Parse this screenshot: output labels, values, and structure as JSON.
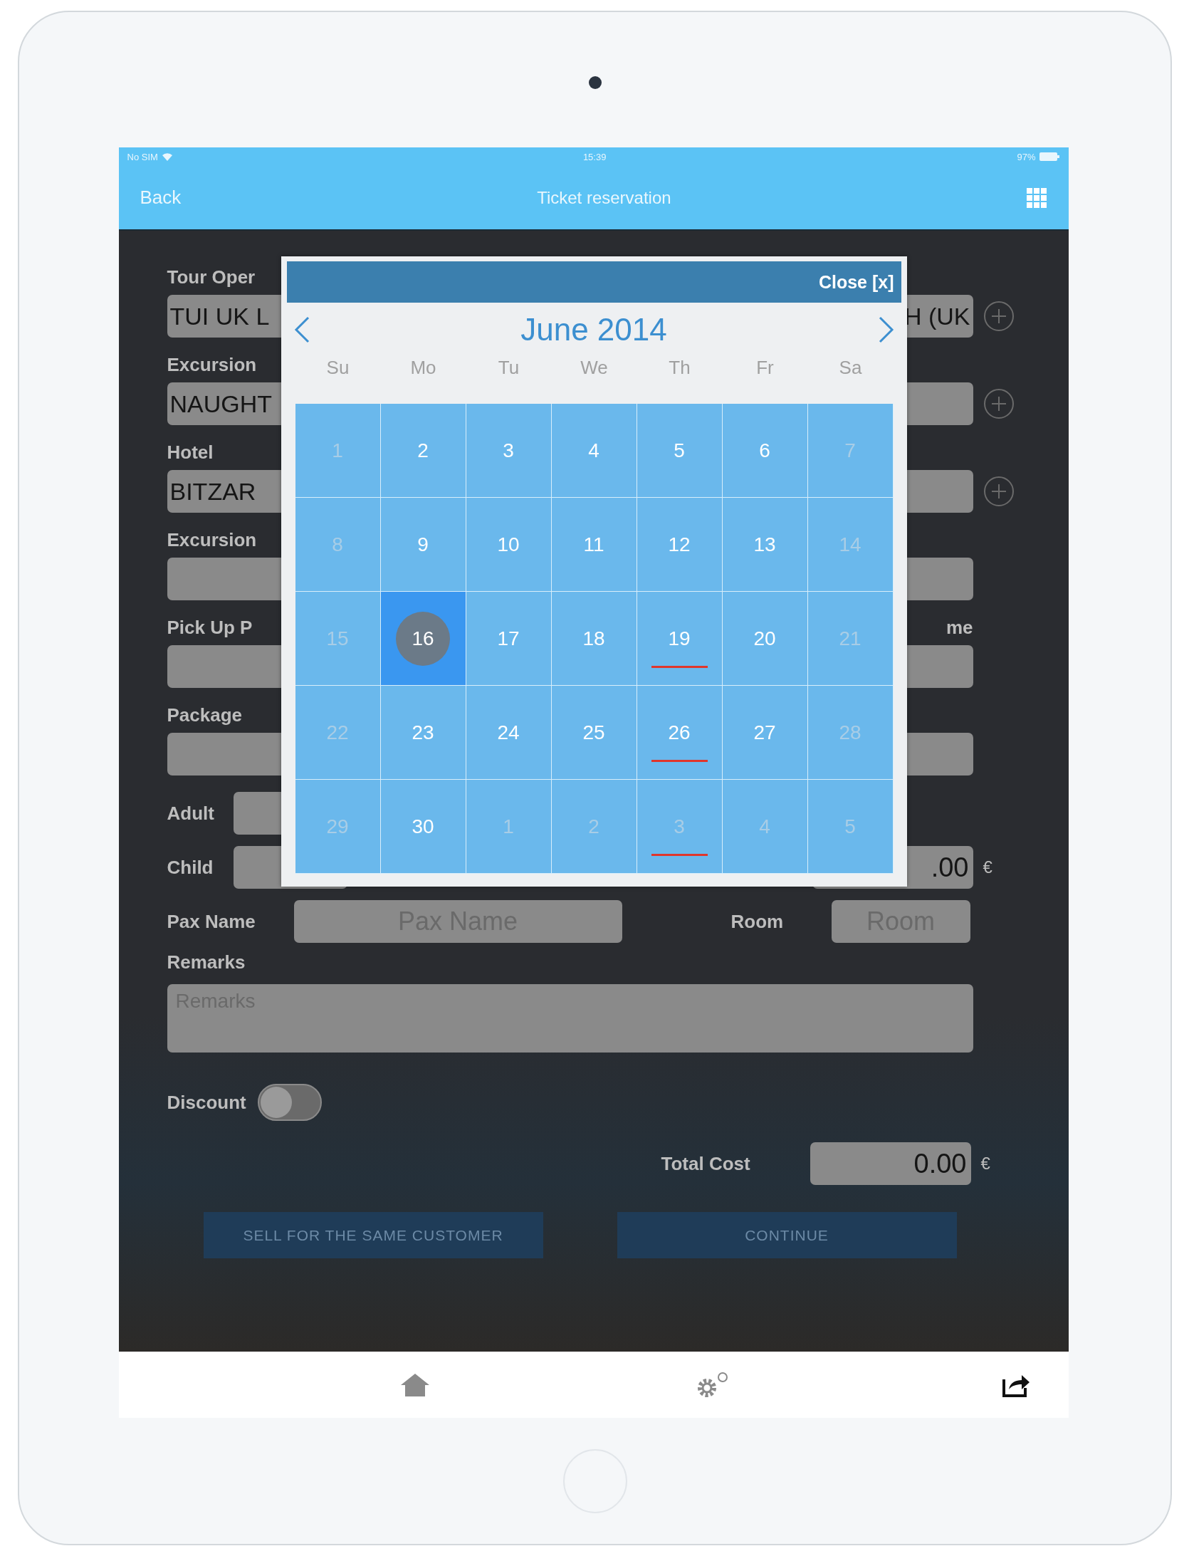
{
  "status_bar": {
    "carrier": "No SIM",
    "time": "15:39",
    "battery": "97%"
  },
  "nav_bar": {
    "back": "Back",
    "title": "Ticket reservation"
  },
  "form": {
    "rows": [
      {
        "label": "Tour Oper",
        "value": "TUI UK L",
        "value_end": "H (UK",
        "add": true
      },
      {
        "label": "Excursion",
        "value": "NAUGHT",
        "add": true
      },
      {
        "label": "Hotel",
        "value": "BITZAR",
        "add": true
      },
      {
        "label": "Excursion",
        "add": false
      },
      {
        "label": "Pick Up P",
        "right_label": "me",
        "add": false
      },
      {
        "label": "Package",
        "add": false
      }
    ],
    "counts": [
      {
        "label": "Adult"
      },
      {
        "label": "Child",
        "amount": ".00",
        "currency": "€"
      }
    ],
    "pax_name": {
      "label": "Pax Name",
      "placeholder": "Pax Name"
    },
    "room": {
      "label": "Room",
      "placeholder": "Room"
    },
    "remarks": {
      "label": "Remarks",
      "placeholder": "Remarks"
    },
    "discount": {
      "label": "Discount",
      "on": false
    },
    "total": {
      "label": "Total Cost",
      "value": "0.00",
      "currency": "€"
    },
    "buttons": [
      "SELL FOR THE SAME CUSTOMER",
      "CONTINUE"
    ]
  },
  "calendar": {
    "close": "Close [x]",
    "month": "June 2014",
    "weekdays": [
      "Su",
      "Mo",
      "Tu",
      "We",
      "Th",
      "Fr",
      "Sa"
    ],
    "days": [
      {
        "label": "1",
        "muted": true,
        "selected": false,
        "marked": false
      },
      {
        "label": "2",
        "muted": false,
        "selected": false,
        "marked": false
      },
      {
        "label": "3",
        "muted": false,
        "selected": false,
        "marked": false
      },
      {
        "label": "4",
        "muted": false,
        "selected": false,
        "marked": false
      },
      {
        "label": "5",
        "muted": false,
        "selected": false,
        "marked": false
      },
      {
        "label": "6",
        "muted": false,
        "selected": false,
        "marked": false
      },
      {
        "label": "7",
        "muted": true,
        "selected": false,
        "marked": false
      },
      {
        "label": "8",
        "muted": true,
        "selected": false,
        "marked": false
      },
      {
        "label": "9",
        "muted": false,
        "selected": false,
        "marked": false
      },
      {
        "label": "10",
        "muted": false,
        "selected": false,
        "marked": false
      },
      {
        "label": "11",
        "muted": false,
        "selected": false,
        "marked": false
      },
      {
        "label": "12",
        "muted": false,
        "selected": false,
        "marked": false
      },
      {
        "label": "13",
        "muted": false,
        "selected": false,
        "marked": false
      },
      {
        "label": "14",
        "muted": true,
        "selected": false,
        "marked": false
      },
      {
        "label": "15",
        "muted": true,
        "selected": false,
        "marked": false
      },
      {
        "label": "16",
        "muted": false,
        "selected": true,
        "marked": false
      },
      {
        "label": "17",
        "muted": false,
        "selected": false,
        "marked": false
      },
      {
        "label": "18",
        "muted": false,
        "selected": false,
        "marked": false
      },
      {
        "label": "19",
        "muted": false,
        "selected": false,
        "marked": true
      },
      {
        "label": "20",
        "muted": false,
        "selected": false,
        "marked": false
      },
      {
        "label": "21",
        "muted": true,
        "selected": false,
        "marked": false
      },
      {
        "label": "22",
        "muted": true,
        "selected": false,
        "marked": false
      },
      {
        "label": "23",
        "muted": false,
        "selected": false,
        "marked": false
      },
      {
        "label": "24",
        "muted": false,
        "selected": false,
        "marked": false
      },
      {
        "label": "25",
        "muted": false,
        "selected": false,
        "marked": false
      },
      {
        "label": "26",
        "muted": false,
        "selected": false,
        "marked": true
      },
      {
        "label": "27",
        "muted": false,
        "selected": false,
        "marked": false
      },
      {
        "label": "28",
        "muted": true,
        "selected": false,
        "marked": false
      },
      {
        "label": "29",
        "muted": true,
        "selected": false,
        "marked": false
      },
      {
        "label": "30",
        "muted": false,
        "selected": false,
        "marked": false
      },
      {
        "label": "1",
        "muted": true,
        "selected": false,
        "marked": false
      },
      {
        "label": "2",
        "muted": true,
        "selected": false,
        "marked": false
      },
      {
        "label": "3",
        "muted": true,
        "selected": false,
        "marked": true
      },
      {
        "label": "4",
        "muted": true,
        "selected": false,
        "marked": false
      },
      {
        "label": "5",
        "muted": true,
        "selected": false,
        "marked": false
      }
    ]
  }
}
